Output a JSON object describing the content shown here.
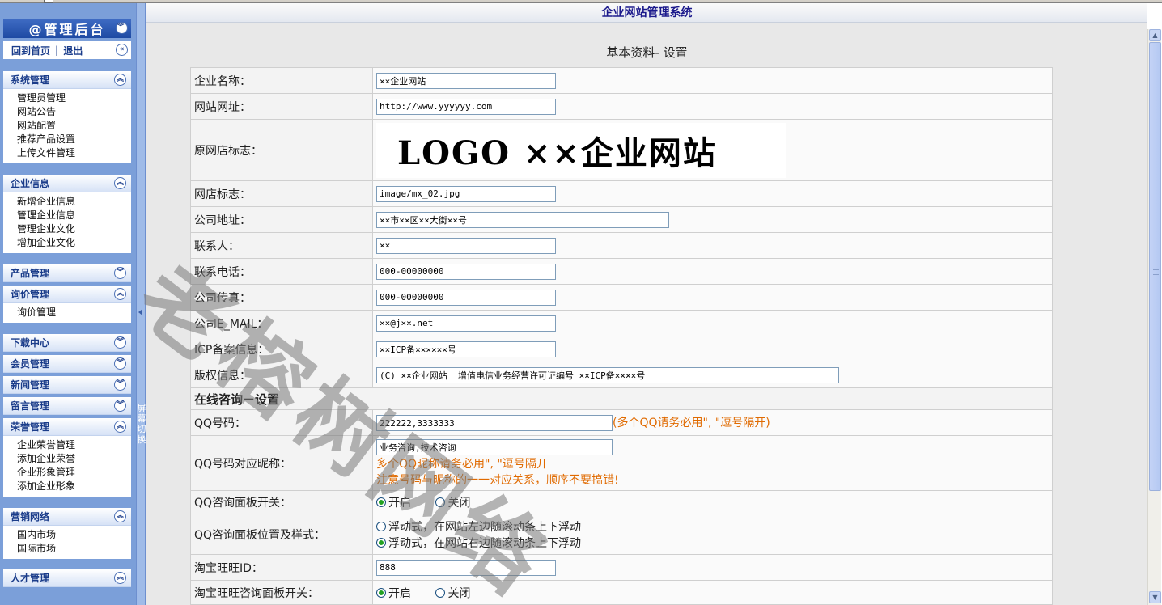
{
  "header": {
    "system_title": "企业网站管理系统"
  },
  "sidebar": {
    "admin_title": "@管理后台",
    "home_link": "回到首页",
    "separator": "|",
    "logout_link": "退出",
    "groups": [
      {
        "title": "系统管理",
        "expanded": true,
        "items": [
          "管理员管理",
          "网站公告",
          "网站配置",
          "推荐产品设置",
          "上传文件管理"
        ]
      },
      {
        "title": "企业信息",
        "expanded": true,
        "items": [
          "新增企业信息",
          "管理企业信息",
          "管理企业文化",
          "增加企业文化"
        ]
      },
      {
        "title": "产品管理",
        "expanded": false,
        "items": []
      },
      {
        "title": "询价管理",
        "expanded": true,
        "items": [
          "询价管理"
        ]
      },
      {
        "title": "下载中心",
        "expanded": false,
        "items": []
      },
      {
        "title": "会员管理",
        "expanded": false,
        "items": []
      },
      {
        "title": "新闻管理",
        "expanded": false,
        "items": []
      },
      {
        "title": "留言管理",
        "expanded": false,
        "items": []
      },
      {
        "title": "荣誉管理",
        "expanded": true,
        "items": [
          "企业荣誉管理",
          "添加企业荣誉",
          "企业形象管理",
          "添加企业形象"
        ]
      },
      {
        "title": "营销网络",
        "expanded": true,
        "items": [
          "国内市场",
          "国际市场"
        ]
      },
      {
        "title": "人才管理",
        "expanded": true,
        "items": []
      }
    ],
    "splitter_label": "屏幕切换"
  },
  "page": {
    "subtitle": "基本资料- 设置",
    "watermark": "老榕树网络",
    "fields": {
      "company_name": {
        "label": "企业名称：",
        "value": "××企业网站"
      },
      "site_url": {
        "label": "网站网址：",
        "value": "http://www.yyyyyy.com"
      },
      "old_logo": {
        "label": "原网店标志：",
        "image_text": "LOGO ××企业网站"
      },
      "logo": {
        "label": "网店标志：",
        "value": "image/mx_02.jpg"
      },
      "address": {
        "label": "公司地址：",
        "value": "××市××区××大街××号"
      },
      "contact": {
        "label": "联系人：",
        "value": "××"
      },
      "phone": {
        "label": "联系电话：",
        "value": "000-00000000"
      },
      "fax": {
        "label": "公司传真：",
        "value": "000-00000000"
      },
      "email": {
        "label": "公司E_MAIL：",
        "value": "××@j××.net"
      },
      "icp": {
        "label": "ICP备案信息：",
        "value": "××ICP备××××××号"
      },
      "copyright": {
        "label": "版权信息：",
        "value": "(C) ××企业网站  增值电信业务经营许可证编号 ××ICP备××××号"
      }
    },
    "online_section": "在线咨询－设置",
    "qq": {
      "label": "QQ号码：",
      "value": "222222,3333333",
      "hint": "(多个QQ请务必用\", \"逗号隔开)"
    },
    "qq_nick": {
      "label": "QQ号码对应昵称：",
      "value": "业务咨询,技术咨询",
      "hint1": "多个QQ昵称请务必用\", \"逗号隔开",
      "hint2": "注意号码与昵称的一一对应关系，顺序不要搞错!"
    },
    "qq_panel": {
      "label": "QQ咨询面板开关：",
      "on": "开启",
      "off": "关闭",
      "selected": "on"
    },
    "qq_position": {
      "label": "QQ咨询面板位置及样式：",
      "opt_left": "浮动式，在网站左边随滚动条上下浮动",
      "opt_right": "浮动式，在网站右边随滚动条上下浮动",
      "selected": "right"
    },
    "taobao": {
      "label": "淘宝旺旺ID：",
      "value": "888"
    },
    "taobao_panel": {
      "label": "淘宝旺旺咨询面板开关：",
      "on": "开启",
      "off": "关闭",
      "selected": "on"
    }
  }
}
